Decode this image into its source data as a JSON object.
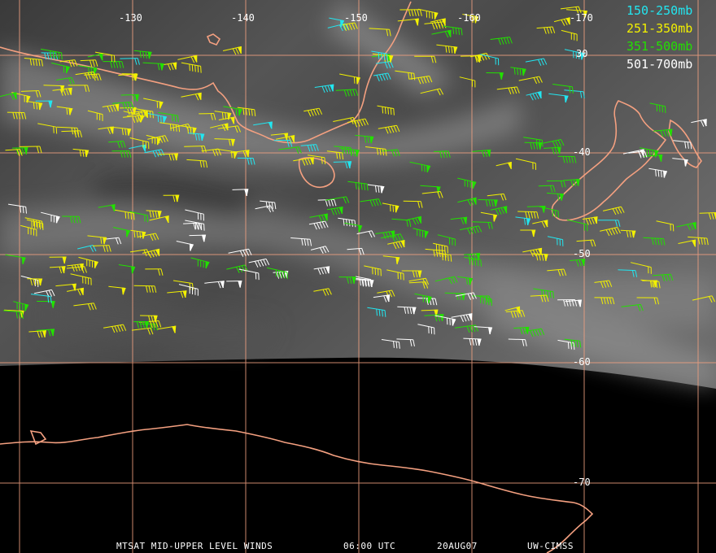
{
  "map": {
    "longitude_labels": [
      "-130",
      "-140",
      "-150",
      "-160",
      "-170"
    ],
    "latitude_labels": [
      "30",
      "-40",
      "-50",
      "-60",
      "-70"
    ]
  },
  "legend": [
    {
      "label": "150-250mb",
      "color": "#22e6f0"
    },
    {
      "label": "251-350mb",
      "color": "#f2f000"
    },
    {
      "label": "351-500mb",
      "color": "#22e000"
    },
    {
      "label": "501-700mb",
      "color": "#ffffff"
    }
  ],
  "footer": {
    "product": "MTSAT MID-UPPER LEVEL WINDS",
    "time": "06:00 UTC",
    "date": "20AUG07",
    "credit": "UW-CIMSS"
  },
  "colors": {
    "gridline": "#f0a080",
    "coastline": "#f4a080",
    "no_data": "#000000"
  }
}
